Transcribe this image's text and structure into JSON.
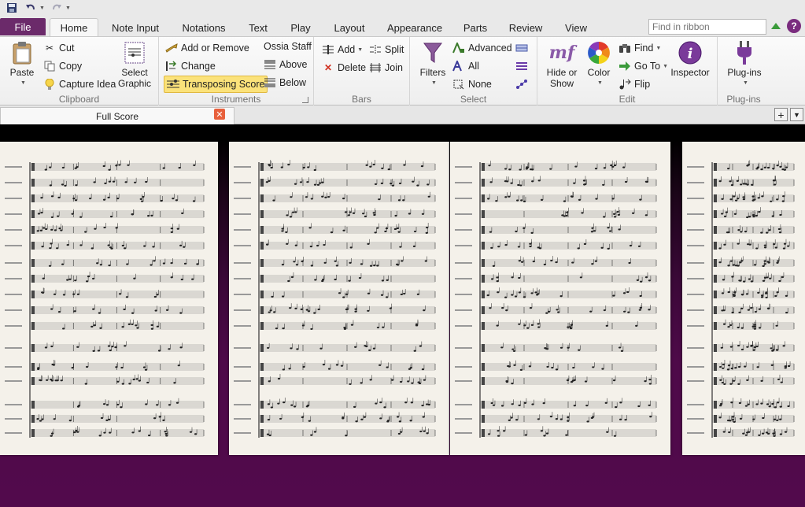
{
  "quick_access": {
    "save_icon": "save-icon",
    "undo_icon": "undo-icon",
    "redo_icon": "redo-icon"
  },
  "tabs": {
    "file": "File",
    "items": [
      "Home",
      "Note Input",
      "Notations",
      "Text",
      "Play",
      "Layout",
      "Appearance",
      "Parts",
      "Review",
      "View"
    ],
    "active": "Home",
    "search_placeholder": "Find in ribbon"
  },
  "ribbon": {
    "clipboard": {
      "label": "Clipboard",
      "paste": "Paste",
      "cut": "Cut",
      "copy": "Copy",
      "capture_idea": "Capture Idea",
      "select_graphic": [
        "Select",
        "Graphic"
      ]
    },
    "instruments": {
      "label": "Instruments",
      "add_or_remove": "Add or Remove",
      "change": "Change",
      "transposing_score": "Transposing Score",
      "ossia_staff": "Ossia Staff",
      "above": "Above",
      "below": "Below"
    },
    "bars": {
      "label": "Bars",
      "add": "Add",
      "delete": "Delete",
      "split": "Split",
      "join": "Join"
    },
    "select": {
      "label": "Select",
      "filters": "Filters",
      "advanced": "Advanced",
      "all": "All",
      "none": "None"
    },
    "edit": {
      "label": "Edit",
      "hide_or_show": [
        "Hide or",
        "Show"
      ],
      "color": "Color",
      "find": "Find",
      "go_to": "Go To",
      "flip": "Flip",
      "inspector": "Inspector"
    },
    "plugins": {
      "label": "Plug-ins",
      "plugins_button": "Plug-ins"
    }
  },
  "document": {
    "tab_title": "Full Score",
    "close_icon": "close-icon",
    "add_icon": "plus-icon",
    "menu_icon": "menu-icon"
  },
  "colors": {
    "file_tab": "#6b2a6a",
    "workspace": "#4e0a49",
    "pressed_button": "#fbe27a",
    "paper": "#f4f1ea"
  }
}
